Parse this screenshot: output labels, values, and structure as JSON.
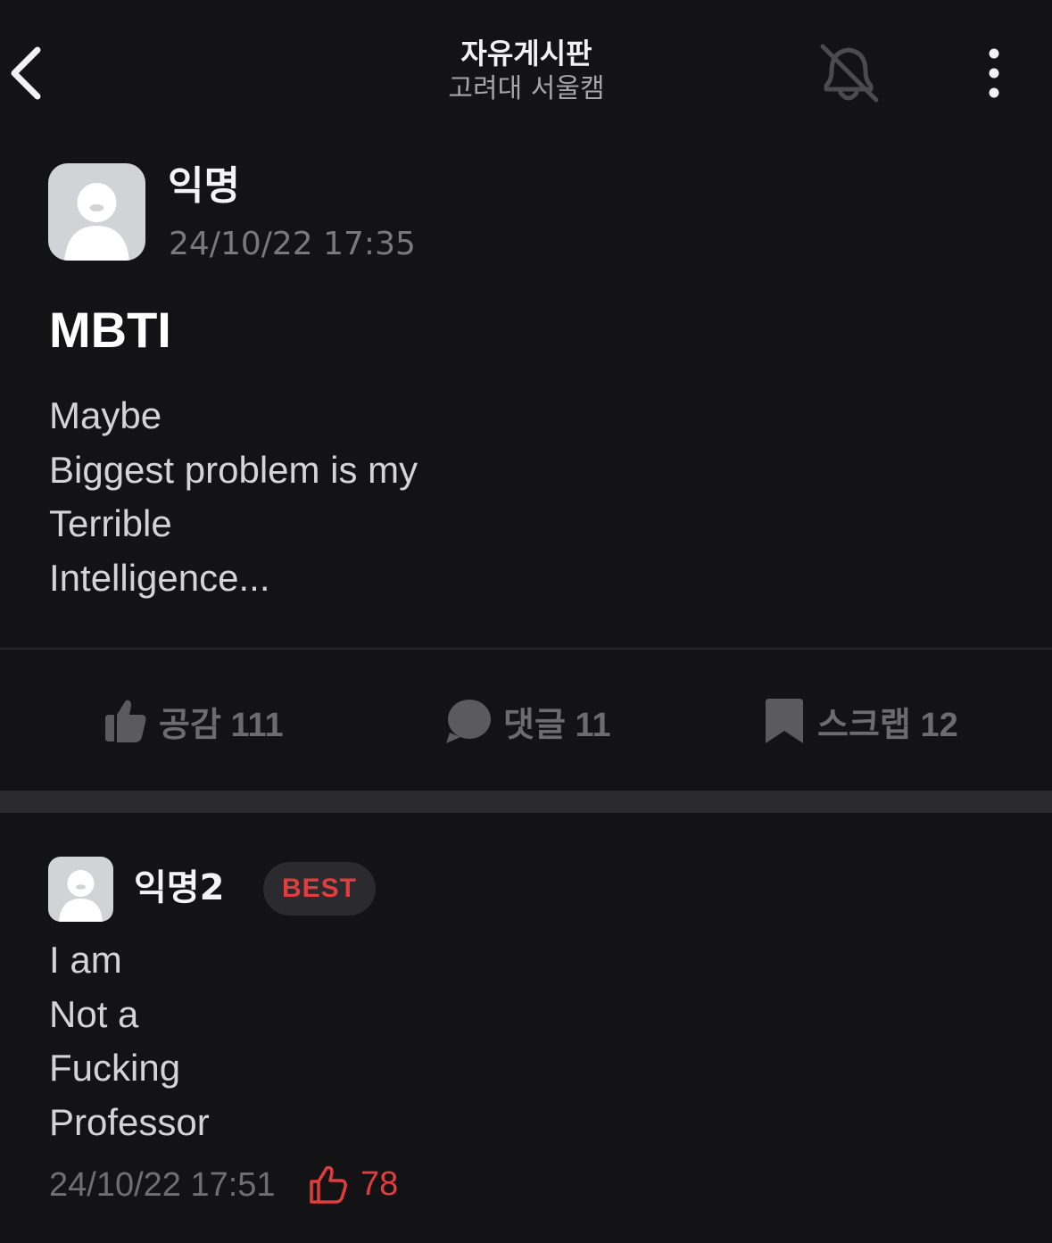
{
  "header": {
    "title": "자유게시판",
    "subtitle": "고려대 서울캠",
    "icons": [
      "chevron-left-icon",
      "bell-off-icon",
      "more-vertical-icon"
    ]
  },
  "post": {
    "author": "익명",
    "date": "24/10/22 17:35",
    "title": "MBTI",
    "body_lines": [
      "Maybe",
      "Biggest problem is my",
      "Terrible",
      "Intelligence..."
    ]
  },
  "actions": {
    "like_label": "공감 111",
    "comment_label": "댓글 11",
    "scrap_label": "스크랩 12"
  },
  "comment": {
    "author": "익명2",
    "badge": "BEST",
    "body_lines": [
      "I am",
      "Not a",
      "Fucking",
      "Professor"
    ],
    "date": "24/10/22 17:51",
    "likes": "78"
  },
  "colors": {
    "background": "#131215",
    "accent_red": "#e03d3d",
    "muted": "#6c6c70"
  }
}
